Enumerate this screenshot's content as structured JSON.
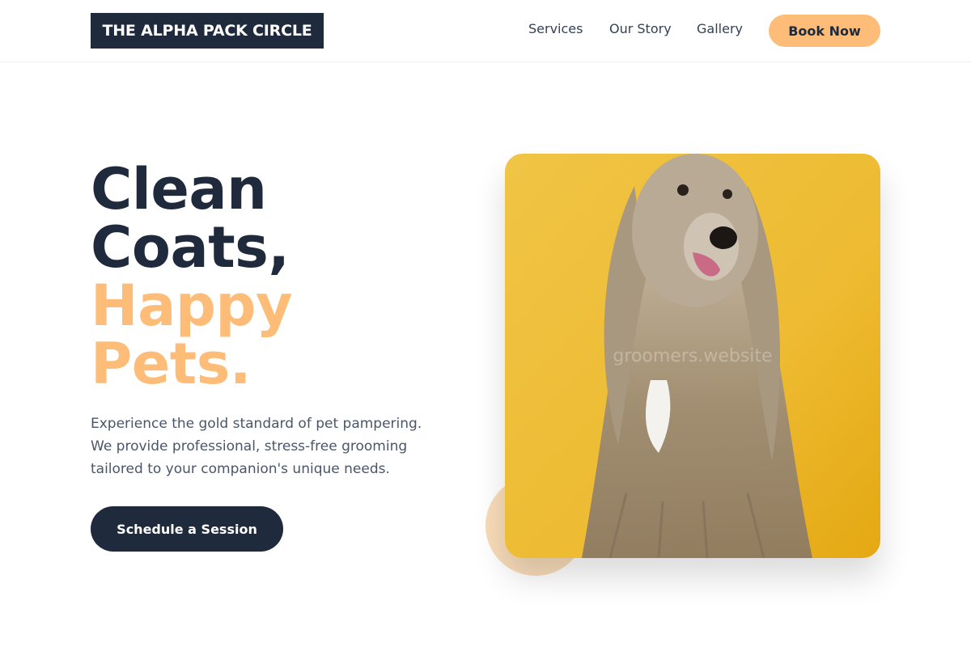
{
  "header": {
    "logo": "THE ALPHA PACK CIRCLE",
    "nav": [
      "Services",
      "Our Story",
      "Gallery"
    ],
    "cta": "Book Now"
  },
  "hero": {
    "headline_dark": [
      "Clean",
      "Coats,"
    ],
    "headline_accent": [
      "Happy",
      "Pets."
    ],
    "description": [
      "Experience the gold standard of pet pampering.",
      "We provide professional, stress-free grooming",
      "tailored to your companion's unique needs."
    ],
    "cta": "Schedule a Session",
    "image_watermark": "groomers.website"
  },
  "colors": {
    "navy": "#1f2a3d",
    "accent": "#fdbd78",
    "photo_background": "#eebf3a"
  }
}
